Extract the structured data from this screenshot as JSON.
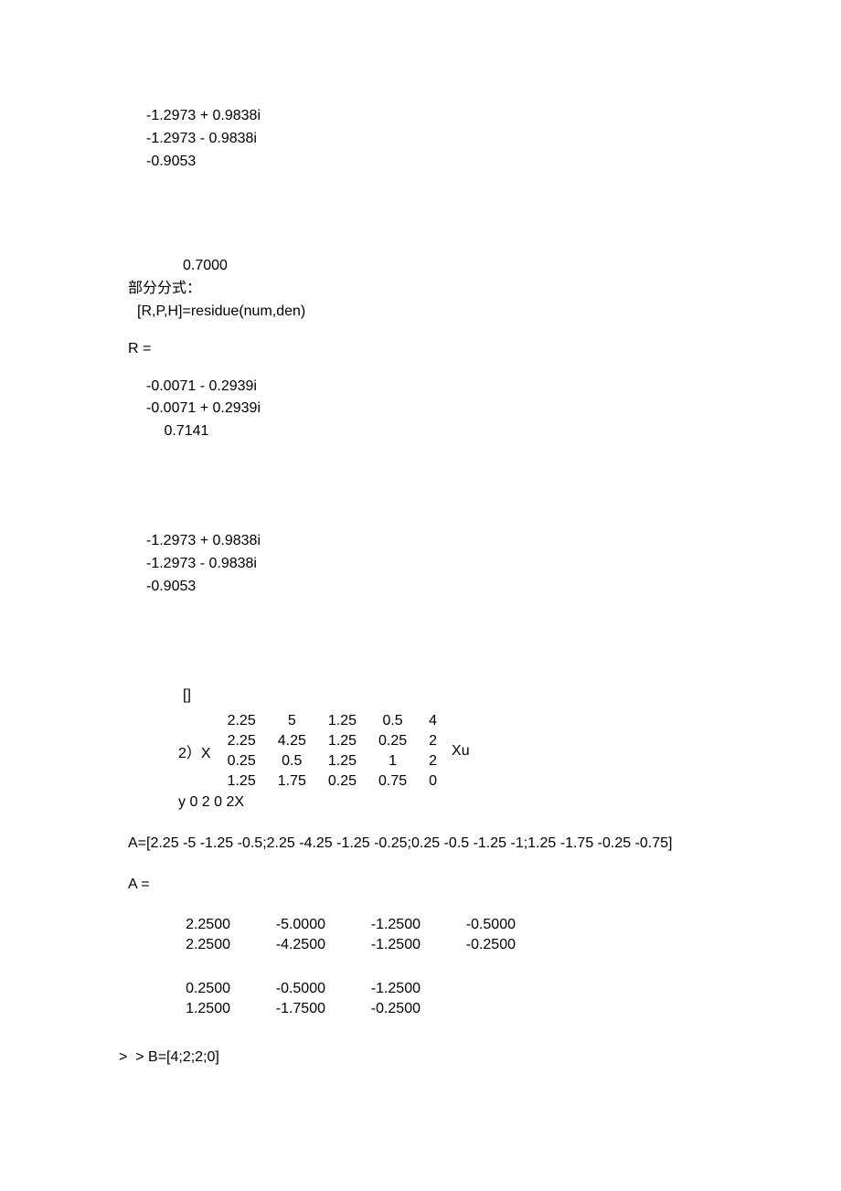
{
  "top_values": {
    "l1": "-1.2973 + 0.9838i",
    "l2": "-1.2973 - 0.9838i",
    "l3": "-0.9053"
  },
  "isolated_value": "0.7000",
  "partial_fraction_label_cn": "部分分式：",
  "residue_call": "[R,P,H]=residue(num,den)",
  "R_label": "R =",
  "R_vals": {
    "r1": "-0.0071 - 0.2939i",
    "r2": "-0.0071 + 0.2939i",
    "r3": " 0.7141"
  },
  "P_vals": {
    "p1": "-1.2973 + 0.9838i",
    "p2": "-1.2973 - 0.9838i",
    "p3": "-0.9053"
  },
  "empty_brackets": "[]",
  "matrix_index_label": "2）X",
  "matrix_right_label": "Xu",
  "matrix_rows": [
    [
      "2.25",
      "5",
      "1.25",
      "0.5",
      "4"
    ],
    [
      "2.25",
      "4.25",
      "1.25",
      "0.25",
      "2"
    ],
    [
      "0.25",
      "0.5",
      "1.25",
      "1",
      "2"
    ],
    [
      "1.25",
      "1.75",
      "0.25",
      "0.75",
      "0"
    ]
  ],
  "y_line": "y 0 2 0 2X",
  "A_assign": "A=[2.25 -5 -1.25 -0.5;2.25 -4.25 -1.25 -0.25;0.25 -0.5 -1.25 -1;1.25 -1.75 -0.25 -0.75]",
  "A_label": "A =",
  "A_rows_top": [
    [
      "2.2500",
      "-5.0000",
      "-1.2500",
      "-0.5000"
    ],
    [
      "2.2500",
      "-4.2500",
      "-1.2500",
      "-0.2500"
    ]
  ],
  "A_rows_bottom": [
    [
      "0.2500",
      "-0.5000",
      "-1.2500",
      ""
    ],
    [
      "1.2500",
      "-1.7500",
      "-0.2500",
      ""
    ]
  ],
  "B_line": ">  > B=[4;2;2;0]"
}
